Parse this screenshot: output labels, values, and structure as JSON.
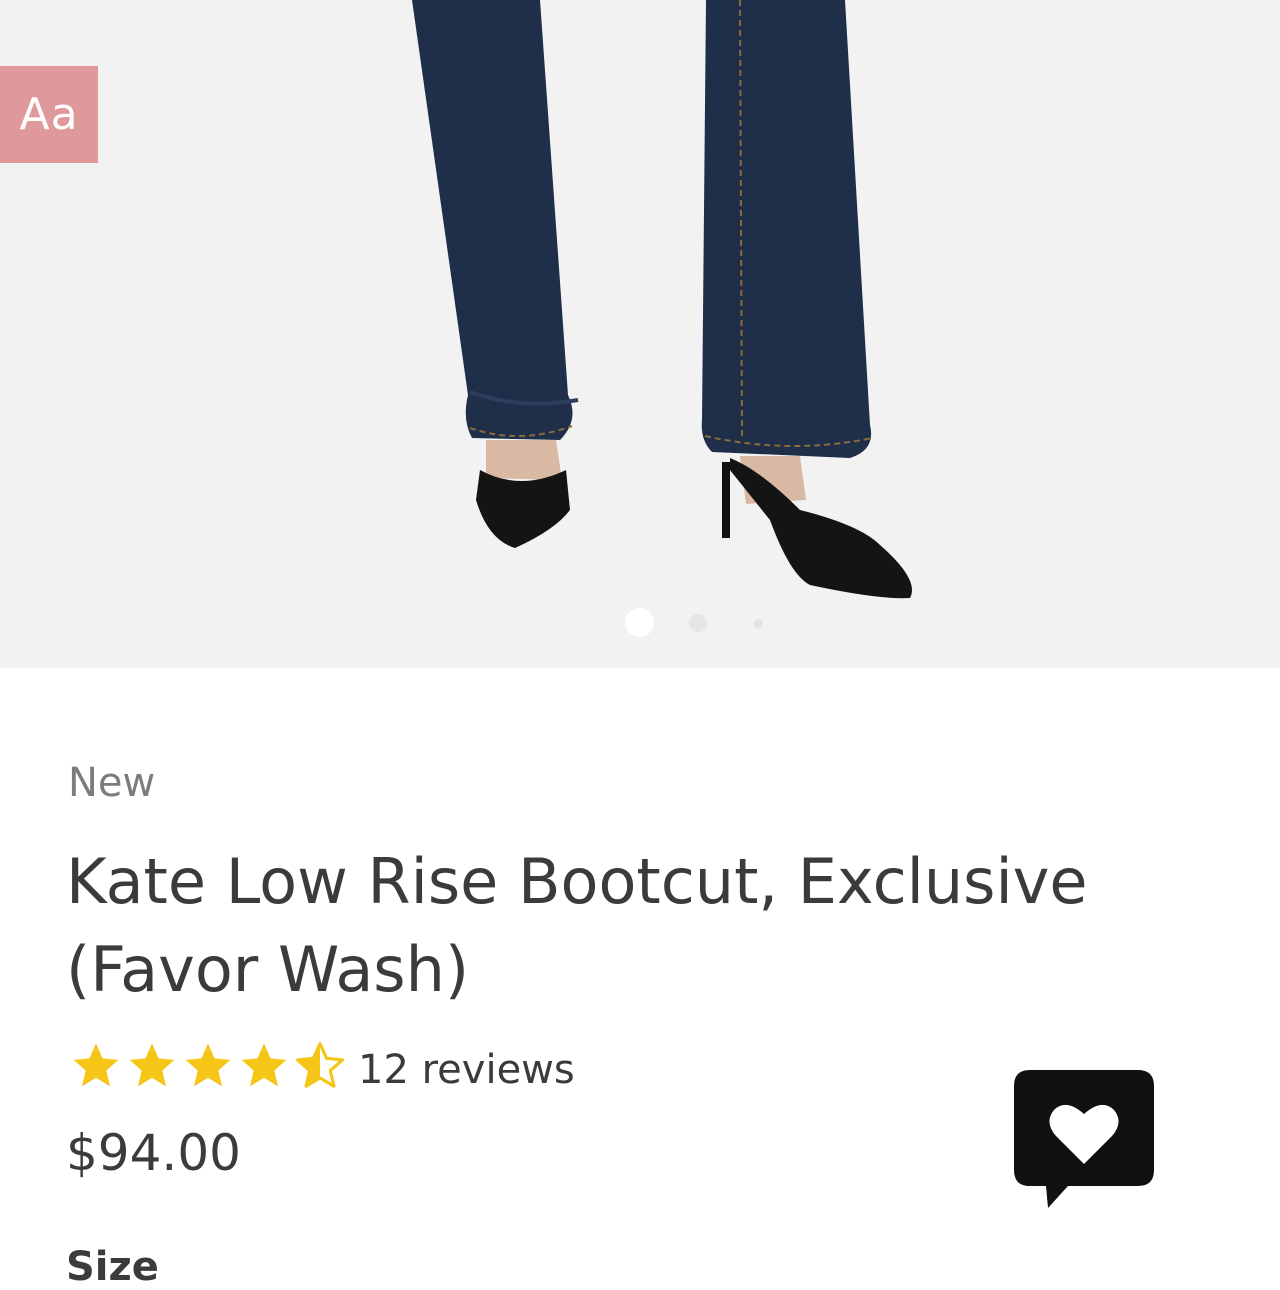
{
  "font_toggle": {
    "label": "Aa"
  },
  "gallery": {
    "image_count": 3,
    "active_index": 0
  },
  "product": {
    "badge": "New",
    "title": "Kate Low Rise Bootcut, Exclusive (Favor Wash)",
    "rating": 4.5,
    "review_count_text": "12 reviews",
    "price": "$94.00"
  },
  "options": {
    "size_label": "Size"
  },
  "icons": {
    "star": "star-icon",
    "half_star": "star-half-icon",
    "favorite": "heart-chat-icon"
  },
  "colors": {
    "font_toggle_bg": "#e0999a",
    "star": "#f5c518",
    "hero_bg": "#f2f2f2",
    "denim": "#1f2f4a"
  }
}
